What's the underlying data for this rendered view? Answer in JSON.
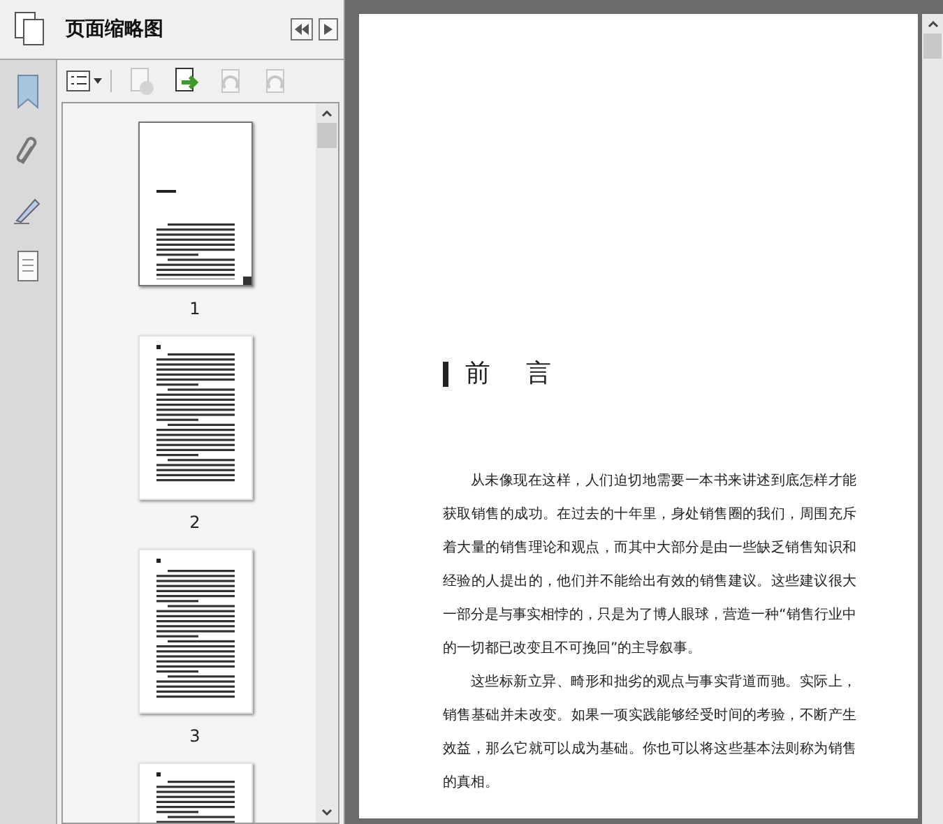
{
  "panel": {
    "title": "页面缩略图"
  },
  "thumbnails": [
    {
      "label": "1",
      "selected": true,
      "kind": "title"
    },
    {
      "label": "2",
      "selected": false,
      "kind": "text"
    },
    {
      "label": "3",
      "selected": false,
      "kind": "section"
    },
    {
      "selected": false,
      "kind": "text"
    }
  ],
  "document": {
    "heading": "前 言",
    "paragraphs": [
      "从未像现在这样，人们迫切地需要一本书来讲述到底怎样才能获取销售的成功。在过去的十年里，身处销售圈的我们，周围充斥着大量的销售理论和观点，而其中大部分是由一些缺乏销售知识和经验的人提出的，他们并不能给出有效的销售建议。这些建议很大一部分是与事实相悖的，只是为了博人眼球，营造一种“销售行业中的一切都已改变且不可挽回”的主导叙事。",
      "这些标新立异、畸形和拙劣的观点与事实背道而驰。实际上，销售基础并未改变。如果一项实践能够经受时间的考验，不断产生效益，那么它就可以成为基础。你也可以将这些基本法则称为销售的真相。"
    ]
  }
}
